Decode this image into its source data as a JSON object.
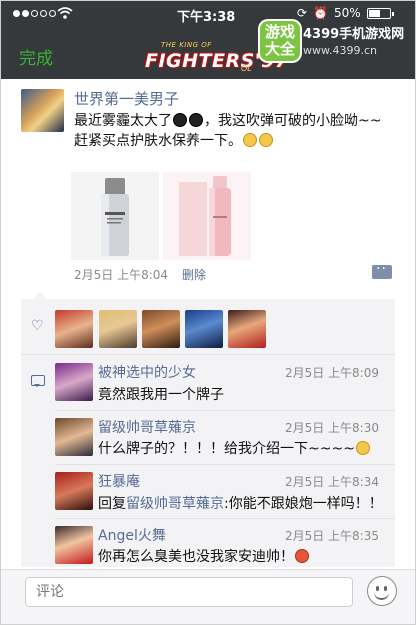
{
  "status_bar": {
    "time": "下午3:38",
    "battery": "50%"
  },
  "header": {
    "done_label": "完成",
    "logo_main": "FIGHTERS'97",
    "logo_top": "THE KING OF",
    "logo_tag": "OL",
    "badge_text": "游戏大全",
    "site_name": "4399手机游戏网",
    "site_url": "www.4399.cn"
  },
  "post": {
    "author": "世界第一美男子",
    "text_part1": "最近雾霾太大了",
    "text_part2": "，我这吹弹可破的小脸呦~~赶紧买点护肤水保养一下。",
    "date": "2月5日 上午8:04",
    "delete_label": "删除",
    "photos": [
      "skincare-bottle-silver",
      "skincare-bottle-pink"
    ]
  },
  "likes": {
    "count": 5
  },
  "comments": [
    {
      "name": "被神选中的少女",
      "time": "2月5日 上午8:09",
      "reply_to": "",
      "prefix": "",
      "text": "竟然跟我用一个牌子"
    },
    {
      "name": "留级帅哥草薙京",
      "time": "2月5日 上午8:30",
      "reply_to": "",
      "prefix": "",
      "text": "什么牌子的？！！！给我介绍一下~~~~"
    },
    {
      "name": "狂暴庵",
      "time": "2月5日 上午8:34",
      "prefix": "回复",
      "reply_to": "留级帅哥草薙京",
      "text": ":你能不跟娘炮一样吗！！"
    },
    {
      "name": "Angel火舞",
      "time": "2月5日 上午8:35",
      "reply_to": "",
      "prefix": "",
      "text": "你再怎么臭美也没我家安迪帅！"
    }
  ],
  "input": {
    "placeholder": "评论"
  },
  "colors": {
    "header": "#35393c",
    "accent_green": "#3cb034",
    "link_blue": "#576b95"
  }
}
